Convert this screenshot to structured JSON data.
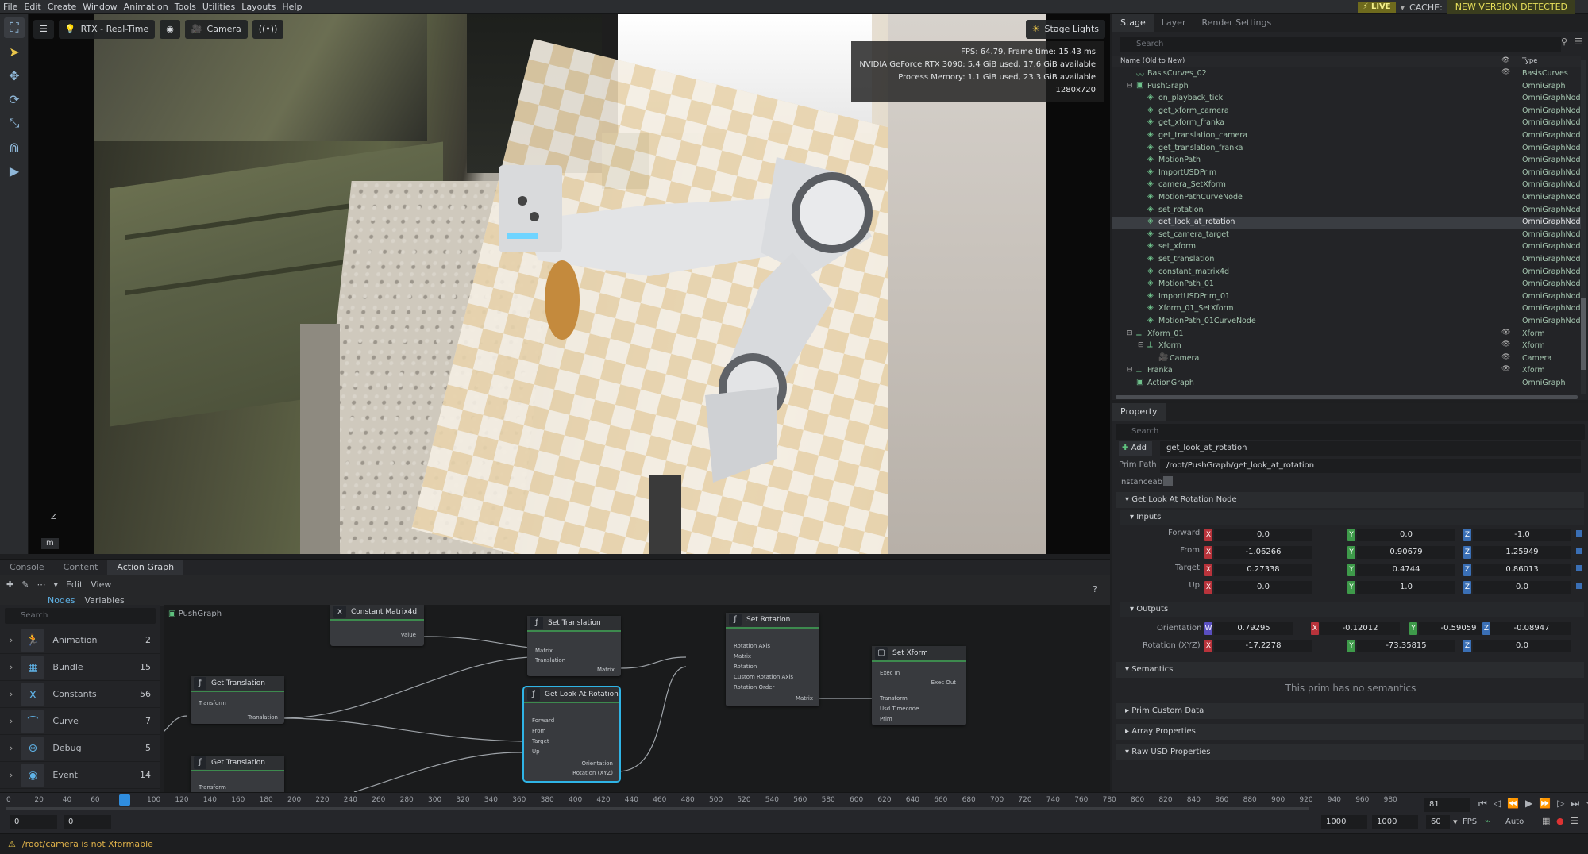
{
  "menu": [
    "File",
    "Edit",
    "Create",
    "Window",
    "Animation",
    "Tools",
    "Utilities",
    "Layouts",
    "Help"
  ],
  "status_right": {
    "live": "LIVE",
    "cache": "CACHE:",
    "new_version": "NEW VERSION DETECTED"
  },
  "viewport": {
    "renderer": "RTX - Real-Time",
    "camera": "Camera",
    "stage_lights": "Stage Lights",
    "stats": [
      "FPS: 64.79, Frame time: 15.43 ms",
      "NVIDIA GeForce RTX 3090: 5.4 GiB used, 17.6 GiB available",
      "Process Memory: 1.1 GiB used, 23.3 GiB available",
      "1280x720"
    ],
    "units": "m",
    "axis": "Z"
  },
  "bottom_tabs": [
    "Console",
    "Content",
    "Action Graph"
  ],
  "graph_toolbar": {
    "edit": "Edit",
    "view": "View",
    "nodes_tab": "Nodes",
    "variables_tab": "Variables",
    "search_placeholder": "Search",
    "help": "?"
  },
  "node_library": [
    {
      "name": "Animation",
      "count": "2",
      "icon": "running-person-icon"
    },
    {
      "name": "Bundle",
      "count": "15",
      "icon": "bundle-icon"
    },
    {
      "name": "Constants",
      "count": "56",
      "icon": "x-icon"
    },
    {
      "name": "Curve",
      "count": "7",
      "icon": "curve-icon"
    },
    {
      "name": "Debug",
      "count": "5",
      "icon": "debug-icon"
    },
    {
      "name": "Event",
      "count": "14",
      "icon": "event-icon"
    }
  ],
  "graph": {
    "breadcrumb": "PushGraph",
    "nodes": {
      "constant_matrix": {
        "title": "Constant Matrix4d",
        "ports": [
          "Value"
        ]
      },
      "set_translation": {
        "title": "Set Translation",
        "ports": [
          "Matrix",
          "Translation",
          "Matrix"
        ]
      },
      "set_rotation": {
        "title": "Set Rotation",
        "ports": [
          "Rotation Axis",
          "Matrix",
          "Rotation",
          "Custom Rotation Axis",
          "Rotation Order",
          "Matrix"
        ]
      },
      "set_xform": {
        "title": "Set Xform",
        "ports": [
          "Exec In",
          "Exec Out",
          "Transform",
          "Usd Timecode",
          "Prim"
        ]
      },
      "get_translation_1": {
        "title": "Get Translation",
        "ports": [
          "Transform",
          "Translation"
        ]
      },
      "get_look_at_rotation": {
        "title": "Get Look At Rotation",
        "ports": [
          "Forward",
          "From",
          "Target",
          "Up",
          "Orientation",
          "Rotation (XYZ)"
        ]
      },
      "get_translation_2": {
        "title": "Get Translation",
        "ports": [
          "Transform"
        ]
      }
    }
  },
  "timeline": {
    "ticks": [
      "0",
      "20",
      "40",
      "60",
      "81",
      "100",
      "120",
      "140",
      "160",
      "180",
      "200",
      "220",
      "240",
      "260",
      "280",
      "300",
      "320",
      "340",
      "360",
      "380",
      "400",
      "420",
      "440",
      "460",
      "480",
      "500",
      "520",
      "540",
      "560",
      "580",
      "600",
      "620",
      "640",
      "660",
      "680",
      "700",
      "720",
      "740",
      "760",
      "780",
      "800",
      "820",
      "840",
      "860",
      "880",
      "900",
      "920",
      "940",
      "960",
      "980"
    ],
    "current_frame": "81",
    "start": "0",
    "start2": "0",
    "end": "1000",
    "end2": "1000",
    "fps": "60",
    "fps_label": "FPS",
    "auto": "Auto"
  },
  "status_message": "/root/camera is not Xformable",
  "stage": {
    "tabs": [
      "Stage",
      "Layer",
      "Render Settings"
    ],
    "search_placeholder": "Search",
    "header_name": "Name (Old to New)",
    "header_type": "Type",
    "rows": [
      {
        "name": "BasisCurves_02",
        "type": "BasisCurves",
        "indent": 1
      },
      {
        "name": "PushGraph",
        "type": "OmniGraph",
        "indent": 1
      },
      {
        "name": "on_playback_tick",
        "type": "OmniGraphNode",
        "indent": 2
      },
      {
        "name": "get_xform_camera",
        "type": "OmniGraphNode",
        "indent": 2
      },
      {
        "name": "get_xform_franka",
        "type": "OmniGraphNode",
        "indent": 2
      },
      {
        "name": "get_translation_camera",
        "type": "OmniGraphNode",
        "indent": 2
      },
      {
        "name": "get_translation_franka",
        "type": "OmniGraphNode",
        "indent": 2
      },
      {
        "name": "MotionPath",
        "type": "OmniGraphNode",
        "indent": 2
      },
      {
        "name": "ImportUSDPrim",
        "type": "OmniGraphNode",
        "indent": 2
      },
      {
        "name": "camera_SetXform",
        "type": "OmniGraphNode",
        "indent": 2
      },
      {
        "name": "MotionPathCurveNode",
        "type": "OmniGraphNode",
        "indent": 2
      },
      {
        "name": "set_rotation",
        "type": "OmniGraphNode",
        "indent": 2
      },
      {
        "name": "get_look_at_rotation",
        "type": "OmniGraphNode",
        "indent": 2,
        "selected": true
      },
      {
        "name": "set_camera_target",
        "type": "OmniGraphNode",
        "indent": 2
      },
      {
        "name": "set_xform",
        "type": "OmniGraphNode",
        "indent": 2
      },
      {
        "name": "set_translation",
        "type": "OmniGraphNode",
        "indent": 2
      },
      {
        "name": "constant_matrix4d",
        "type": "OmniGraphNode",
        "indent": 2
      },
      {
        "name": "MotionPath_01",
        "type": "OmniGraphNode",
        "indent": 2
      },
      {
        "name": "ImportUSDPrim_01",
        "type": "OmniGraphNode",
        "indent": 2
      },
      {
        "name": "Xform_01_SetXform",
        "type": "OmniGraphNode",
        "indent": 2
      },
      {
        "name": "MotionPath_01CurveNode",
        "type": "OmniGraphNode",
        "indent": 2
      },
      {
        "name": "Xform_01",
        "type": "Xform",
        "indent": 1
      },
      {
        "name": "Xform",
        "type": "Xform",
        "indent": 2
      },
      {
        "name": "Camera",
        "type": "Camera",
        "indent": 3
      },
      {
        "name": "Franka",
        "type": "Xform",
        "indent": 1
      },
      {
        "name": "ActionGraph",
        "type": "OmniGraph",
        "indent": 1
      }
    ]
  },
  "property": {
    "tab": "Property",
    "search_placeholder": "Search",
    "add_label": "Add",
    "name_value": "get_look_at_rotation",
    "prim_path_label": "Prim Path",
    "prim_path_value": "/root/PushGraph/get_look_at_rotation",
    "instanceable_label": "Instanceable",
    "node_section": "Get Look At Rotation Node",
    "inputs_section": "Inputs",
    "inputs": [
      {
        "label": "Forward",
        "x": "0.0",
        "y": "0.0",
        "z": "-1.0"
      },
      {
        "label": "From",
        "x": "-1.06266",
        "y": "0.90679",
        "z": "1.25949"
      },
      {
        "label": "Target",
        "x": "0.27338",
        "y": "0.4744",
        "z": "0.86013"
      },
      {
        "label": "Up",
        "x": "0.0",
        "y": "1.0",
        "z": "0.0"
      }
    ],
    "outputs_section": "Outputs",
    "orientation": {
      "label": "Orientation",
      "w": "0.79295",
      "x": "-0.12012",
      "y": "-0.59059",
      "z": "-0.08947"
    },
    "rotation": {
      "label": "Rotation (XYZ)",
      "x": "-17.2278",
      "y": "-73.35815",
      "z": "0.0"
    },
    "semantics_section": "Semantics",
    "semantics_text": "This prim has no semantics",
    "collapsed_sections": [
      "Prim Custom Data",
      "Array Properties",
      "Raw USD Properties"
    ]
  }
}
